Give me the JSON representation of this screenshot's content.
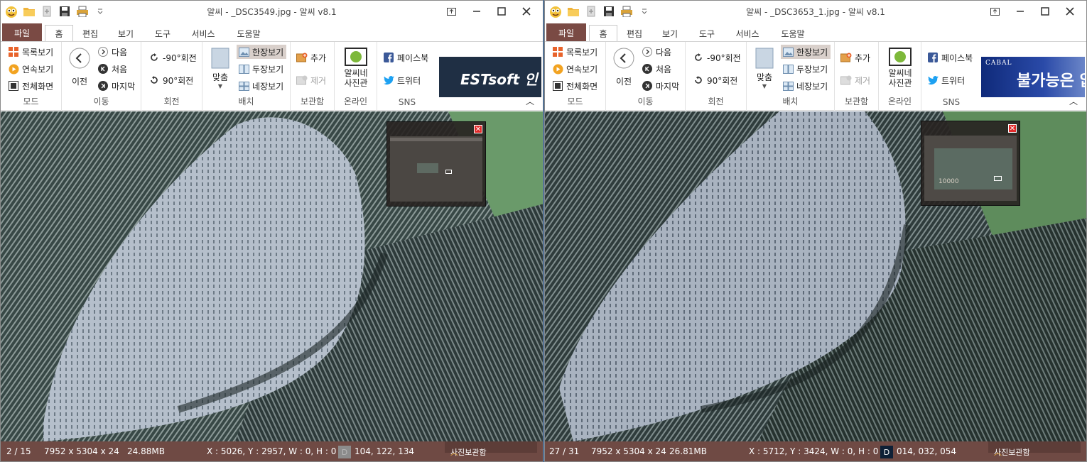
{
  "windows": [
    {
      "title": "알씨 - _DSC3549.jpg - 알씨 v8.1",
      "ad_text": "ESTsoft 인",
      "status": {
        "position": "2 / 15",
        "dimensions": "7952 x 5304 x 24",
        "filesize": "24.88MB",
        "coords": "X : 5026, Y : 2957, W : 0, H : 0",
        "color_chip": "D",
        "color_values": "104, 122, 134",
        "album_label": "사진보관함"
      }
    },
    {
      "title": "알씨 - _DSC3653_1.jpg - 알씨 v8.1",
      "ad_brand": "CABAL",
      "ad_text": "불가능은 없",
      "status": {
        "position": "27 / 31",
        "dimensions": "7952 x 5304 x 24",
        "filesize": "26.81MB",
        "coords": "X : 5712, Y : 3424, W : 0, H : 0",
        "color_chip": "D",
        "color_values": "014, 032, 054",
        "album_label": "사진보관함"
      }
    }
  ],
  "tabs": {
    "file": "파일",
    "home": "홈",
    "edit": "편집",
    "view": "보기",
    "tools": "도구",
    "service": "서비스",
    "help": "도움말"
  },
  "ribbon": {
    "mode": {
      "list": "목록보기",
      "slideshow": "연속보기",
      "fullscreen": "전체화면",
      "label": "모드"
    },
    "move": {
      "prev": "이전",
      "next": "다음",
      "first": "처음",
      "last": "마지막",
      "label": "이동"
    },
    "rotate": {
      "ccw": "-90°회전",
      "cw": "90°회전",
      "label": "회전"
    },
    "layout": {
      "fit": "맞춤",
      "single": "한장보기",
      "double": "두장보기",
      "quad": "네장보기",
      "label": "배치"
    },
    "album": {
      "add": "추가",
      "remove": "제거",
      "label": "보관함"
    },
    "online": {
      "studio1": "알씨네",
      "studio2": "사진관",
      "label": "온라인",
      "badge": "알씨네"
    },
    "sns": {
      "facebook": "페이스북",
      "twitter": "트위터",
      "label": "SNS"
    }
  },
  "navigator_thumb_label": "10000",
  "colors": {
    "status_bg": "#6f4a44",
    "file_tab": "#7a4a44",
    "highlight": "#d9d0cb",
    "close_red": "#e02a2a"
  }
}
